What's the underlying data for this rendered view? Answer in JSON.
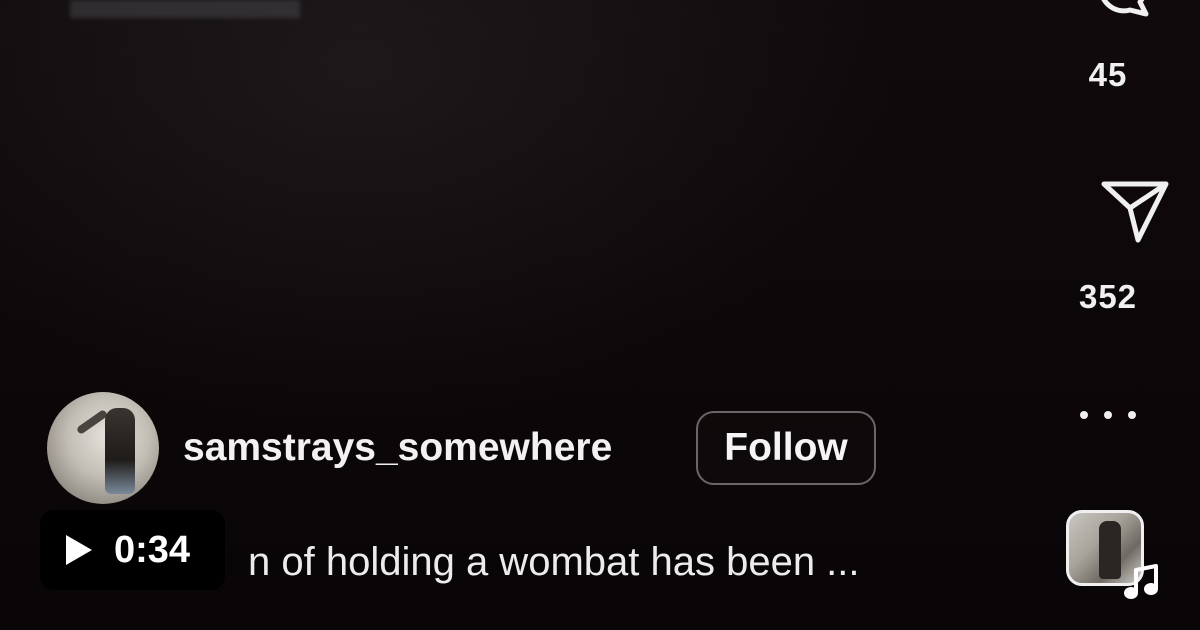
{
  "post": {
    "username": "samstrays_somewhere",
    "follow_label": "Follow",
    "caption": "n of holding a wombat has been ..."
  },
  "actions": {
    "comments_count": "45",
    "shares_count": "352",
    "comment_icon": "comment-bubble-icon",
    "share_icon": "paper-plane-icon",
    "more_icon": "more-horizontal-icon",
    "music_icon": "music-note-icon"
  },
  "video": {
    "duration": "0:34",
    "play_icon": "play-icon"
  },
  "colors": {
    "background": "#0b0608",
    "text": "#f2f2f2",
    "badge": "#000000",
    "follow_border": "#6a6668"
  }
}
